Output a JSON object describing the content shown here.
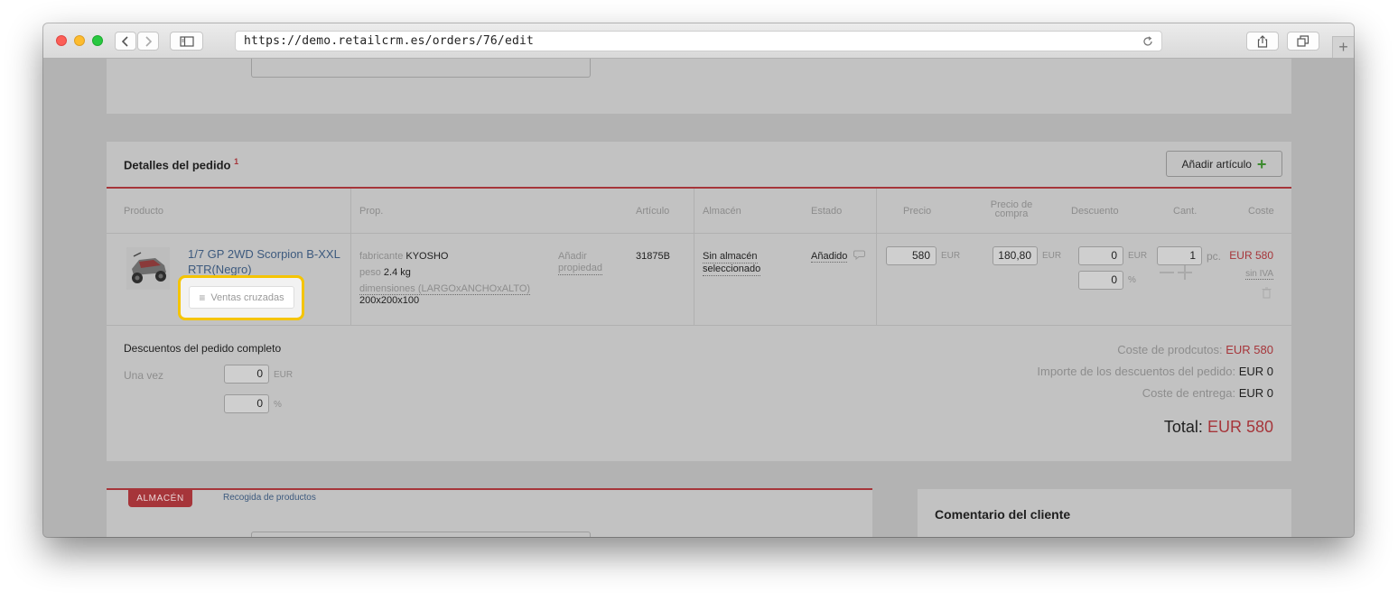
{
  "browser": {
    "url": "https://demo.retailcrm.es/orders/76/edit"
  },
  "order_details": {
    "title": "Detalles del pedido",
    "title_superscript": "1",
    "add_item_label": "Añadir artículo",
    "columns": {
      "product": "Producto",
      "prop": "Prop.",
      "article": "Artículo",
      "warehouse": "Almacén",
      "status": "Estado",
      "price": "Precio",
      "purchase_price_line1": "Precio de",
      "purchase_price_line2": "compra",
      "discount": "Descuento",
      "qty": "Cant.",
      "cost": "Coste"
    },
    "item": {
      "name_line1": "1/7 GP 2WD Scorpion B-XXL",
      "name_line2": "RTR(Negro)",
      "cross_sell_label": "Ventas cruzadas",
      "props": {
        "manufacturer_label": "fabricante",
        "manufacturer_value": "KYOSHO",
        "weight_label": "peso",
        "weight_value": "2.4 kg",
        "dimensions_label": "dimensiones (LARGOxANCHOxALTO)",
        "dimensions_value": "200x200x100",
        "add_property_line1": "Añadir",
        "add_property_line2": "propiedad"
      },
      "article": "31875B",
      "warehouse_line1": "Sin almacén",
      "warehouse_line2": "seleccionado",
      "status": "Añadido",
      "price": "580",
      "price_currency": "EUR",
      "purchase_price": "180,80",
      "purchase_currency": "EUR",
      "discount_amount": "0",
      "discount_currency": "EUR",
      "discount_percent": "0",
      "discount_percent_sign": "%",
      "qty": "1",
      "qty_unit": "pc.",
      "cost": "EUR 580",
      "vat_label": "sin IVA"
    },
    "order_discounts": {
      "title": "Descuentos del pedido completo",
      "once_label": "Una vez",
      "amount": "0",
      "amount_currency": "EUR",
      "percent": "0",
      "percent_sign": "%"
    },
    "totals": {
      "products_cost_label": "Coste de prodcutos:",
      "products_cost_value": "EUR 580",
      "discount_label": "Importe de los descuentos del pedido:",
      "discount_value": "EUR 0",
      "delivery_label": "Coste de entrega:",
      "delivery_value": "EUR 0",
      "total_label": "Total:",
      "total_value": "EUR 580"
    }
  },
  "warehouse_section": {
    "tab_label": "ALMACÉN",
    "link_label": "Recogida de productos"
  },
  "customer_comment": {
    "title": "Comentario del cliente"
  },
  "colors": {
    "accent_red": "#a6353a",
    "highlight_yellow": "#f5c400",
    "add_plus_green": "#3c8a2e"
  }
}
